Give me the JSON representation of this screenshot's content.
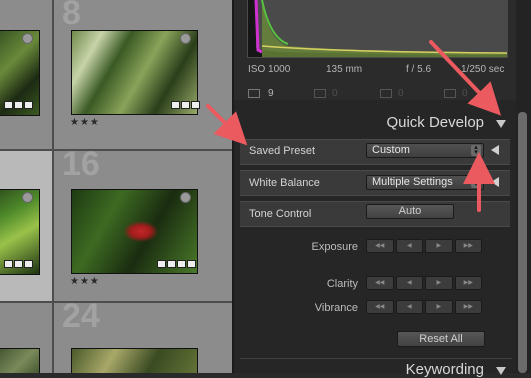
{
  "grid": {
    "cells": [
      {
        "number": "8",
        "rating": "★★★",
        "selected": false
      },
      {
        "number": "16",
        "rating": "★★★",
        "selected": true
      },
      {
        "number": "24",
        "rating": "",
        "selected": false
      }
    ]
  },
  "info": {
    "exif": [
      "ISO 1000",
      "135 mm",
      "f / 5.6",
      "1/250 sec"
    ],
    "tool_counts": [
      "9",
      "0",
      "0",
      "0"
    ]
  },
  "quick_develop": {
    "title": "Quick Develop",
    "saved_preset": {
      "label": "Saved Preset",
      "value": "Custom"
    },
    "white_balance": {
      "label": "White Balance",
      "value": "Multiple Settings"
    },
    "tone_control": {
      "label": "Tone Control",
      "auto_label": "Auto"
    },
    "adjustments": [
      {
        "label": "Exposure"
      },
      {
        "label": "Clarity"
      },
      {
        "label": "Vibrance"
      }
    ],
    "reset_label": "Reset All"
  },
  "keywording": {
    "title": "Keywording"
  },
  "colors": {
    "annotation_arrow": "#ea5a5f",
    "panel_bg": "#262626",
    "grid_selected": "#b9b9b9",
    "grid_normal": "#8c8c8c"
  }
}
